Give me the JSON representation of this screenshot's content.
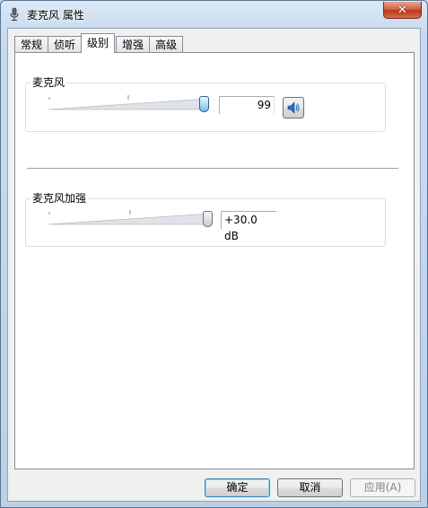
{
  "window": {
    "title": "麦克风 属性",
    "icon": "microphone-icon",
    "close_glyph": "✕"
  },
  "tabs": [
    {
      "label": "常规",
      "active": false
    },
    {
      "label": "侦听",
      "active": false
    },
    {
      "label": "级别",
      "active": true
    },
    {
      "label": "增强",
      "active": false
    },
    {
      "label": "高级",
      "active": false
    }
  ],
  "microphone": {
    "label": "麦克风",
    "value": "99",
    "level_fraction": 0.99,
    "mute_icon": "speaker-icon"
  },
  "boost": {
    "label": "麦克风加强",
    "value": "+30.0 dB",
    "level_fraction": 1.0
  },
  "buttons": {
    "ok": "确定",
    "cancel": "取消",
    "apply": "应用(A)"
  },
  "colors": {
    "thumb_active": "#a7d9f5",
    "default_button_border": "#3c7fb1"
  }
}
